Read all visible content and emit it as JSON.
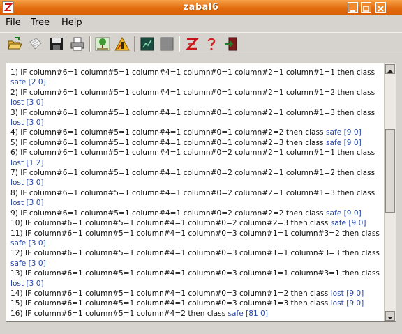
{
  "window": {
    "title": "zabal6"
  },
  "menu": [
    {
      "label": "File",
      "mnemonic": "F",
      "rest": "ile"
    },
    {
      "label": "Tree",
      "mnemonic": "T",
      "rest": "ree"
    },
    {
      "label": "Help",
      "mnemonic": "H",
      "rest": "elp"
    }
  ],
  "toolbar": {
    "icons": [
      "open-folder-icon",
      "new-document-icon",
      "save-icon",
      "print-icon",
      "tree-icon",
      "warning-icon",
      "chart-icon",
      "gray-square-icon",
      "z-logo-icon",
      "help-icon",
      "exit-icon"
    ]
  },
  "rules": [
    {
      "text": "1) IF column#6=1 column#5=1 column#4=1 column#0=1 column#2=1 column#1=1 then class",
      "class": "safe",
      "counts": "[2 0]"
    },
    {
      "text": "2) IF column#6=1 column#5=1 column#4=1 column#0=1 column#2=1 column#1=2 then class",
      "class": "lost",
      "counts": "[3 0]"
    },
    {
      "text": "3) IF column#6=1 column#5=1 column#4=1 column#0=1 column#2=1 column#1=3 then class",
      "class": "lost",
      "counts": "[3 0]"
    },
    {
      "text": "4) IF column#6=1 column#5=1 column#4=1 column#0=1 column#2=2 then class",
      "class": "safe",
      "counts": "[9 0]"
    },
    {
      "text": "5) IF column#6=1 column#5=1 column#4=1 column#0=1 column#2=3 then class",
      "class": "safe",
      "counts": "[9 0]"
    },
    {
      "text": "6) IF column#6=1 column#5=1 column#4=1 column#0=2 column#2=1 column#1=1 then class",
      "class": "lost",
      "counts": "[1 2]"
    },
    {
      "text": "7) IF column#6=1 column#5=1 column#4=1 column#0=2 column#2=1 column#1=2 then class",
      "class": "lost",
      "counts": "[3 0]"
    },
    {
      "text": "8) IF column#6=1 column#5=1 column#4=1 column#0=2 column#2=1 column#1=3 then class",
      "class": "lost",
      "counts": "[3 0]"
    },
    {
      "text": "9) IF column#6=1 column#5=1 column#4=1 column#0=2 column#2=2 then class",
      "class": "safe",
      "counts": "[9 0]"
    },
    {
      "text": "10) IF column#6=1 column#5=1 column#4=1 column#0=2 column#2=3 then class",
      "class": "safe",
      "counts": "[9 0]"
    },
    {
      "text": "11) IF column#6=1 column#5=1 column#4=1 column#0=3 column#1=1 column#3=2 then class",
      "class": "safe",
      "counts": "[3 0]"
    },
    {
      "text": "12) IF column#6=1 column#5=1 column#4=1 column#0=3 column#1=1 column#3=3 then class",
      "class": "safe",
      "counts": "[3 0]"
    },
    {
      "text": "13) IF column#6=1 column#5=1 column#4=1 column#0=3 column#1=1 column#3=1 then class",
      "class": "lost",
      "counts": "[3 0]"
    },
    {
      "text": "14) IF column#6=1 column#5=1 column#4=1 column#0=3 column#1=2 then class",
      "class": "lost",
      "counts": "[9 0]"
    },
    {
      "text": "15) IF column#6=1 column#5=1 column#4=1 column#0=3 column#1=3 then class",
      "class": "lost",
      "counts": "[9 0]"
    },
    {
      "text": "16) IF column#6=1 column#5=1 column#4=2 then class",
      "class": "safe",
      "counts": "[81 0]"
    }
  ]
}
